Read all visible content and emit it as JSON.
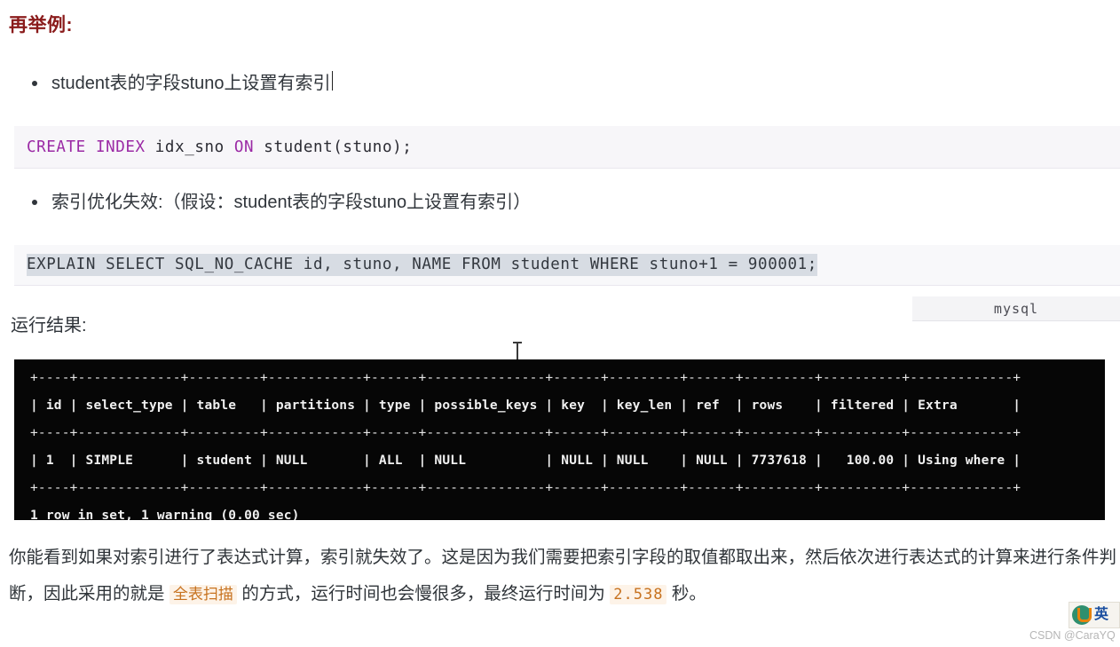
{
  "heading": "再举例:",
  "bullets": [
    {
      "text": "student表的字段stuno上设置有索引",
      "has_caret": true
    },
    {
      "text": "索引优化失效:（假设：student表的字段stuno上设置有索引）",
      "has_caret": false
    }
  ],
  "code_blocks": [
    {
      "language": "",
      "selected": false,
      "tokens": [
        {
          "text": "CREATE",
          "kind": "keyword"
        },
        {
          "text": " ",
          "kind": "plain"
        },
        {
          "text": "INDEX",
          "kind": "keyword"
        },
        {
          "text": " idx_sno ",
          "kind": "plain"
        },
        {
          "text": "ON",
          "kind": "keyword"
        },
        {
          "text": " student(stuno);",
          "kind": "plain"
        }
      ],
      "full_text": "CREATE INDEX idx_sno ON student(stuno);"
    },
    {
      "language": "mysql",
      "selected": true,
      "tokens": [
        {
          "text": "EXPLAIN SELECT SQL_NO_CACHE id, stuno, NAME FROM student WHERE stuno+1 = 900001;",
          "kind": "selected"
        }
      ],
      "full_text": "EXPLAIN SELECT SQL_NO_CACHE id, stuno, NAME FROM student WHERE stuno+1 = 900001;"
    }
  ],
  "language_tag": "mysql",
  "result_label": "运行结果:",
  "terminal": {
    "columns": [
      "id",
      "select_type",
      "table",
      "partitions",
      "type",
      "possible_keys",
      "key",
      "key_len",
      "ref",
      "rows",
      "filtered",
      "Extra"
    ],
    "rows": [
      [
        "1",
        "SIMPLE",
        "student",
        "NULL",
        "ALL",
        "NULL",
        "NULL",
        "NULL",
        "NULL",
        "7737618",
        "100.00",
        "Using where"
      ]
    ],
    "lines": [
      "+----+-------------+---------+------------+------+---------------+------+---------+------+---------+----------+-------------+",
      "| id | select_type | table   | partitions | type | possible_keys | key  | key_len | ref  | rows    | filtered | Extra       |",
      "+----+-------------+---------+------------+------+---------------+------+---------+------+---------+----------+-------------+",
      "| 1  | SIMPLE      | student | NULL       | ALL  | NULL          | NULL | NULL    | NULL | 7737618 |   100.00 | Using where |",
      "+----+-------------+---------+------------+------+---------------+------+---------+------+---------+----------+-------------+",
      "1 row in set, 1 warning (0.00 sec)"
    ],
    "status_line": "1 row in set, 1 warning (0.00 sec)"
  },
  "paragraph": {
    "part1": "你能看到如果对索引进行了表达式计算，索引就失效了。这是因为我们需要把索引字段的取值都取出来，然后依次进行表达式的计算来进行条件判断，因此采用的就是 ",
    "highlight": "全表扫描",
    "part2": " 的方式，运行时间也会慢很多，最终运行时间为 ",
    "number": "2.538",
    "part3": " 秒。"
  },
  "watermark": {
    "logo_text": "英",
    "credit": "CSDN @CaraYQ"
  },
  "colors": {
    "heading": "#8a1b1b",
    "keyword": "#9b2aa5",
    "selection": "#d7dce3",
    "terminal_bg": "#060606",
    "terminal_fg": "#f0f0f0",
    "inline_code": "#c7721f"
  }
}
